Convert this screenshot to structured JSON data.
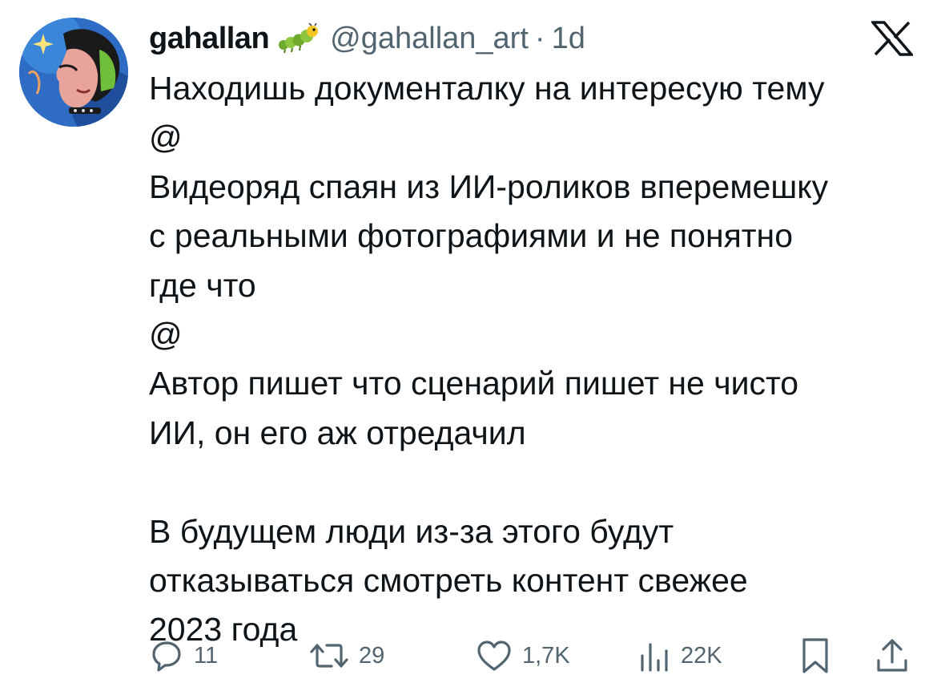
{
  "author": {
    "display_name": "gahallan",
    "name_emoji": "caterpillar-emoji",
    "handle": "@gahallan_art",
    "separator": "·",
    "time": "1d"
  },
  "platform_icon": "x-logo-icon",
  "tweet": {
    "lines": [
      "Находишь документалку на интересую тему",
      "@",
      "Видеоряд спаян из ИИ-роликов вперемешку",
      "с реальными фотографиями и не понятно",
      "где что",
      "@",
      "Автор пишет что сценарий пишет не чисто",
      "ИИ, он его аж отредачил",
      "",
      "В будущем люди из-за этого будут",
      "отказываться смотреть контент свежее",
      "2023 года"
    ]
  },
  "actions": {
    "reply": {
      "icon": "reply-icon",
      "count": "11"
    },
    "retweet": {
      "icon": "retweet-icon",
      "count": "29"
    },
    "like": {
      "icon": "heart-icon",
      "count": "1,7K"
    },
    "views": {
      "icon": "views-icon",
      "count": "22K"
    },
    "bookmark": {
      "icon": "bookmark-icon"
    },
    "share": {
      "icon": "share-icon"
    }
  }
}
